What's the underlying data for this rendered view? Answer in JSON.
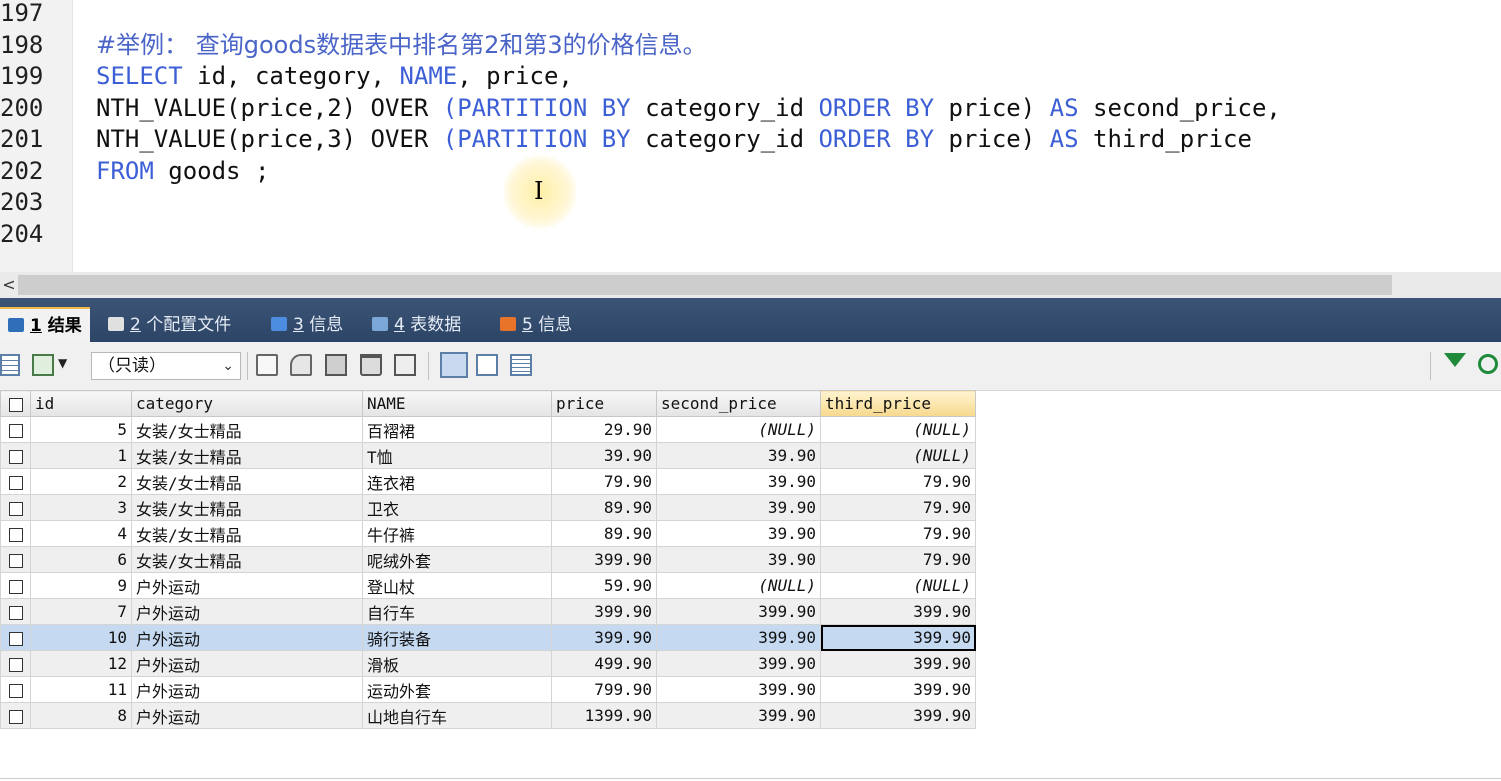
{
  "editor": {
    "lines": [
      {
        "num": "197",
        "tokens": []
      },
      {
        "num": "198",
        "tokens": [
          {
            "t": "#举例： 查询goods数据表中排名第2和第3的价格信息。",
            "k": "cm"
          }
        ]
      },
      {
        "num": "199",
        "tokens": [
          {
            "t": "SELECT",
            "k": "kw"
          },
          {
            "t": " id, category, ",
            "k": ""
          },
          {
            "t": "NAME",
            "k": "kw"
          },
          {
            "t": ", price,",
            "k": ""
          }
        ]
      },
      {
        "num": "200",
        "tokens": [
          {
            "t": "NTH_VALUE(price,2) OVER ",
            "k": ""
          },
          {
            "t": "(PARTITION BY",
            "k": "kw"
          },
          {
            "t": " category_id ",
            "k": ""
          },
          {
            "t": "ORDER BY",
            "k": "kw"
          },
          {
            "t": " price) ",
            "k": ""
          },
          {
            "t": "AS",
            "k": "kw"
          },
          {
            "t": " second_price,",
            "k": ""
          }
        ]
      },
      {
        "num": "201",
        "tokens": [
          {
            "t": "NTH_VALUE(price,3) OVER ",
            "k": ""
          },
          {
            "t": "(PARTITION BY",
            "k": "kw"
          },
          {
            "t": " category_id ",
            "k": ""
          },
          {
            "t": "ORDER BY",
            "k": "kw"
          },
          {
            "t": " price) ",
            "k": ""
          },
          {
            "t": "AS",
            "k": "kw"
          },
          {
            "t": " third_price",
            "k": ""
          }
        ]
      },
      {
        "num": "202",
        "tokens": [
          {
            "t": "FROM",
            "k": "kw"
          },
          {
            "t": " goods ;",
            "k": ""
          }
        ]
      },
      {
        "num": "203",
        "tokens": []
      },
      {
        "num": "204",
        "tokens": []
      }
    ],
    "cursor_glyph": "I"
  },
  "scrollbar": {
    "left_arrow": "<"
  },
  "tabs": [
    {
      "num": "1",
      "label": "结果",
      "active": true,
      "icon": "result-grid-icon",
      "color": "#2f6fb8"
    },
    {
      "num": "2",
      "label": "个配置文件",
      "active": false,
      "icon": "profile-icon",
      "color": "#e0e0e0"
    },
    {
      "num": "3",
      "label": "信息",
      "active": false,
      "icon": "info-icon",
      "color": "#4d8de0"
    },
    {
      "num": "4",
      "label": "表数据",
      "active": false,
      "icon": "table-data-icon",
      "color": "#7aa6d8"
    },
    {
      "num": "5",
      "label": "信息",
      "active": false,
      "icon": "info-color-icon",
      "color": "#e8742a"
    }
  ],
  "toolbar": {
    "readonly_label": "（只读）",
    "filter_icon_color": "#1e8a3a"
  },
  "grid": {
    "columns": [
      "id",
      "category",
      "NAME",
      "price",
      "second_price",
      "third_price"
    ],
    "sorted_column": "third_price",
    "rows": [
      {
        "id": "5",
        "category": "女装/女士精品",
        "name": "百褶裙",
        "price": "29.90",
        "second_price": "(NULL)",
        "third_price": "(NULL)"
      },
      {
        "id": "1",
        "category": "女装/女士精品",
        "name": "T恤",
        "price": "39.90",
        "second_price": "39.90",
        "third_price": "(NULL)"
      },
      {
        "id": "2",
        "category": "女装/女士精品",
        "name": "连衣裙",
        "price": "79.90",
        "second_price": "39.90",
        "third_price": "79.90"
      },
      {
        "id": "3",
        "category": "女装/女士精品",
        "name": "卫衣",
        "price": "89.90",
        "second_price": "39.90",
        "third_price": "79.90"
      },
      {
        "id": "4",
        "category": "女装/女士精品",
        "name": "牛仔裤",
        "price": "89.90",
        "second_price": "39.90",
        "third_price": "79.90"
      },
      {
        "id": "6",
        "category": "女装/女士精品",
        "name": "呢绒外套",
        "price": "399.90",
        "second_price": "39.90",
        "third_price": "79.90"
      },
      {
        "id": "9",
        "category": "户外运动",
        "name": "登山杖",
        "price": "59.90",
        "second_price": "(NULL)",
        "third_price": "(NULL)"
      },
      {
        "id": "7",
        "category": "户外运动",
        "name": "自行车",
        "price": "399.90",
        "second_price": "399.90",
        "third_price": "399.90"
      },
      {
        "id": "10",
        "category": "户外运动",
        "name": "骑行装备",
        "price": "399.90",
        "second_price": "399.90",
        "third_price": "399.90",
        "selected": true
      },
      {
        "id": "12",
        "category": "户外运动",
        "name": "滑板",
        "price": "499.90",
        "second_price": "399.90",
        "third_price": "399.90"
      },
      {
        "id": "11",
        "category": "户外运动",
        "name": "运动外套",
        "price": "799.90",
        "second_price": "399.90",
        "third_price": "399.90"
      },
      {
        "id": "8",
        "category": "户外运动",
        "name": "山地自行车",
        "price": "1399.90",
        "second_price": "399.90",
        "third_price": "399.90"
      }
    ]
  }
}
